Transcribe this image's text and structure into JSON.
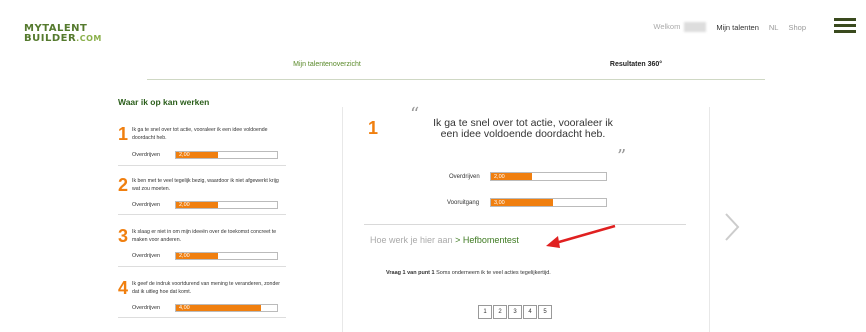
{
  "header": {
    "logo_line1": "MYTALENT",
    "logo_line2": "BUILDER",
    "logo_dotcom": ".COM",
    "welcome": "Welkom",
    "nav": [
      "Mijn talenten",
      "NL",
      "Shop"
    ]
  },
  "tabs": [
    {
      "label": "Mijn talentenoverzicht",
      "active": false
    },
    {
      "label": "Resultaten 360°",
      "active": true
    }
  ],
  "left": {
    "title": "Waar ik op kan werken",
    "items": [
      {
        "num": "1",
        "text": "Ik ga te snel over tot actie, vooraleer ik een idee voldoende doordacht heb.",
        "label": "Overdrijven",
        "value": "2,00",
        "fraction": 0.42
      },
      {
        "num": "2",
        "text": "Ik ben met te veel tegelijk bezig, waardoor ik niet afgewerkt krijg wat zou moeten.",
        "label": "Overdrijven",
        "value": "2,00",
        "fraction": 0.42
      },
      {
        "num": "3",
        "text": "Ik slaag er niet in om mijn ideeën over de toekomst concreet te maken voor anderen.",
        "label": "Overdrijven",
        "value": "2,00",
        "fraction": 0.42
      },
      {
        "num": "4",
        "text": "Ik geef de indruk voortdurend van mening te veranderen, zonder dat ik uitleg hoe dat komt.",
        "label": "Overdrijven",
        "value": "4,00",
        "fraction": 0.84
      }
    ]
  },
  "main": {
    "num": "1",
    "quote": "Ik ga te snel over tot actie, vooraleer ik een idee voldoende doordacht heb.",
    "bars": [
      {
        "label": "Overdrijven",
        "value": "2,00",
        "fraction": 0.36
      },
      {
        "label": "Vooruitgang",
        "value": "3,00",
        "fraction": 0.54
      }
    ],
    "how_prefix": "Hoe werk je hier aan",
    "how_link": "> Hefbomentest",
    "question_bold": "Vraag 1 van punt 1",
    "question_text": "Soms onderneem ik te veel acties tegelijkertijd.",
    "options": [
      "1",
      "2",
      "3",
      "4",
      "5"
    ]
  },
  "colors": {
    "accent": "#f07f0f",
    "green": "#3e7a21",
    "arrow": "#e02020"
  }
}
